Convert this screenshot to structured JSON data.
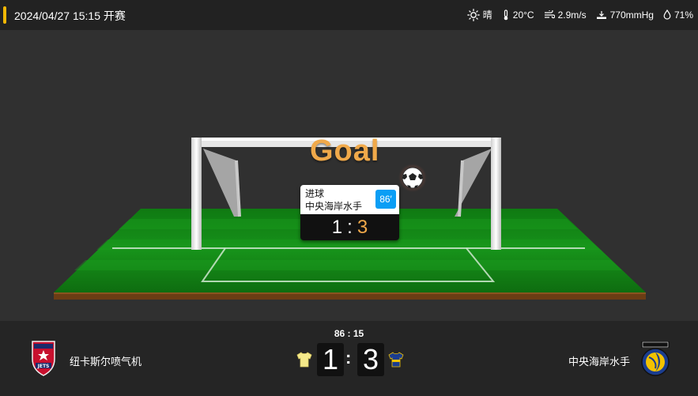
{
  "header": {
    "datetime": "2024/04/27 15:15 开赛",
    "weather": {
      "condition": "晴",
      "condition_icon": "sun-icon",
      "temperature": "20°C",
      "wind": "2.9m/s",
      "pressure": "770mmHg",
      "humidity": "71%"
    }
  },
  "stage": {
    "title": "Goal",
    "event": {
      "label": "进球",
      "team": "中央海岸水手",
      "minute": "86′",
      "home_score": "1",
      "separator": ":",
      "away_score": "3"
    }
  },
  "match": {
    "clock": "86 : 15",
    "home": {
      "name": "纽卡斯尔喷气机",
      "score": "1",
      "kit_color": "#f5e98a"
    },
    "away": {
      "name": "中央海岸水手",
      "score": "3",
      "kit_color": "#1b3d8f"
    },
    "score_separator": ":"
  },
  "colors": {
    "accent": "#f2b705",
    "goal_text": "#f0a94a",
    "minute_badge": "#0a9ef5",
    "grass": "#1a8a1a"
  }
}
